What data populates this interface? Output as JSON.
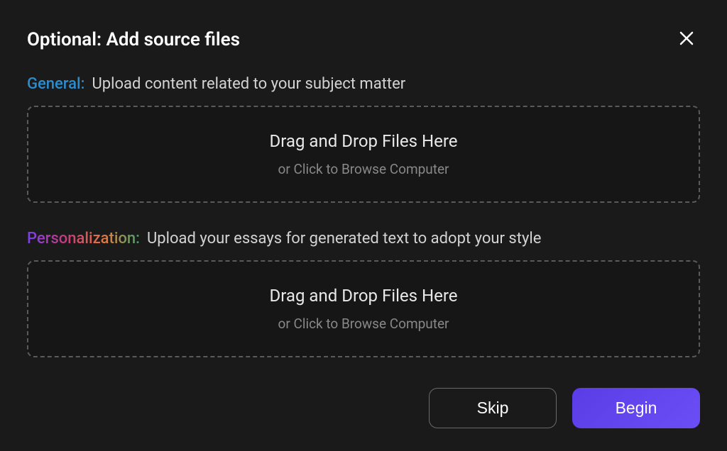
{
  "header": {
    "title": "Optional: Add source files"
  },
  "general": {
    "prefix": "General:",
    "description": "Upload content related to your subject matter",
    "dropzone": {
      "primary": "Drag and Drop Files Here",
      "secondary": "or Click to Browse Computer"
    }
  },
  "personalization": {
    "prefix": "Personalization:",
    "description": "Upload your essays for generated text to adopt your style",
    "dropzone": {
      "primary": "Drag and Drop Files Here",
      "secondary": "or Click to Browse Computer"
    }
  },
  "footer": {
    "skip_label": "Skip",
    "begin_label": "Begin"
  }
}
